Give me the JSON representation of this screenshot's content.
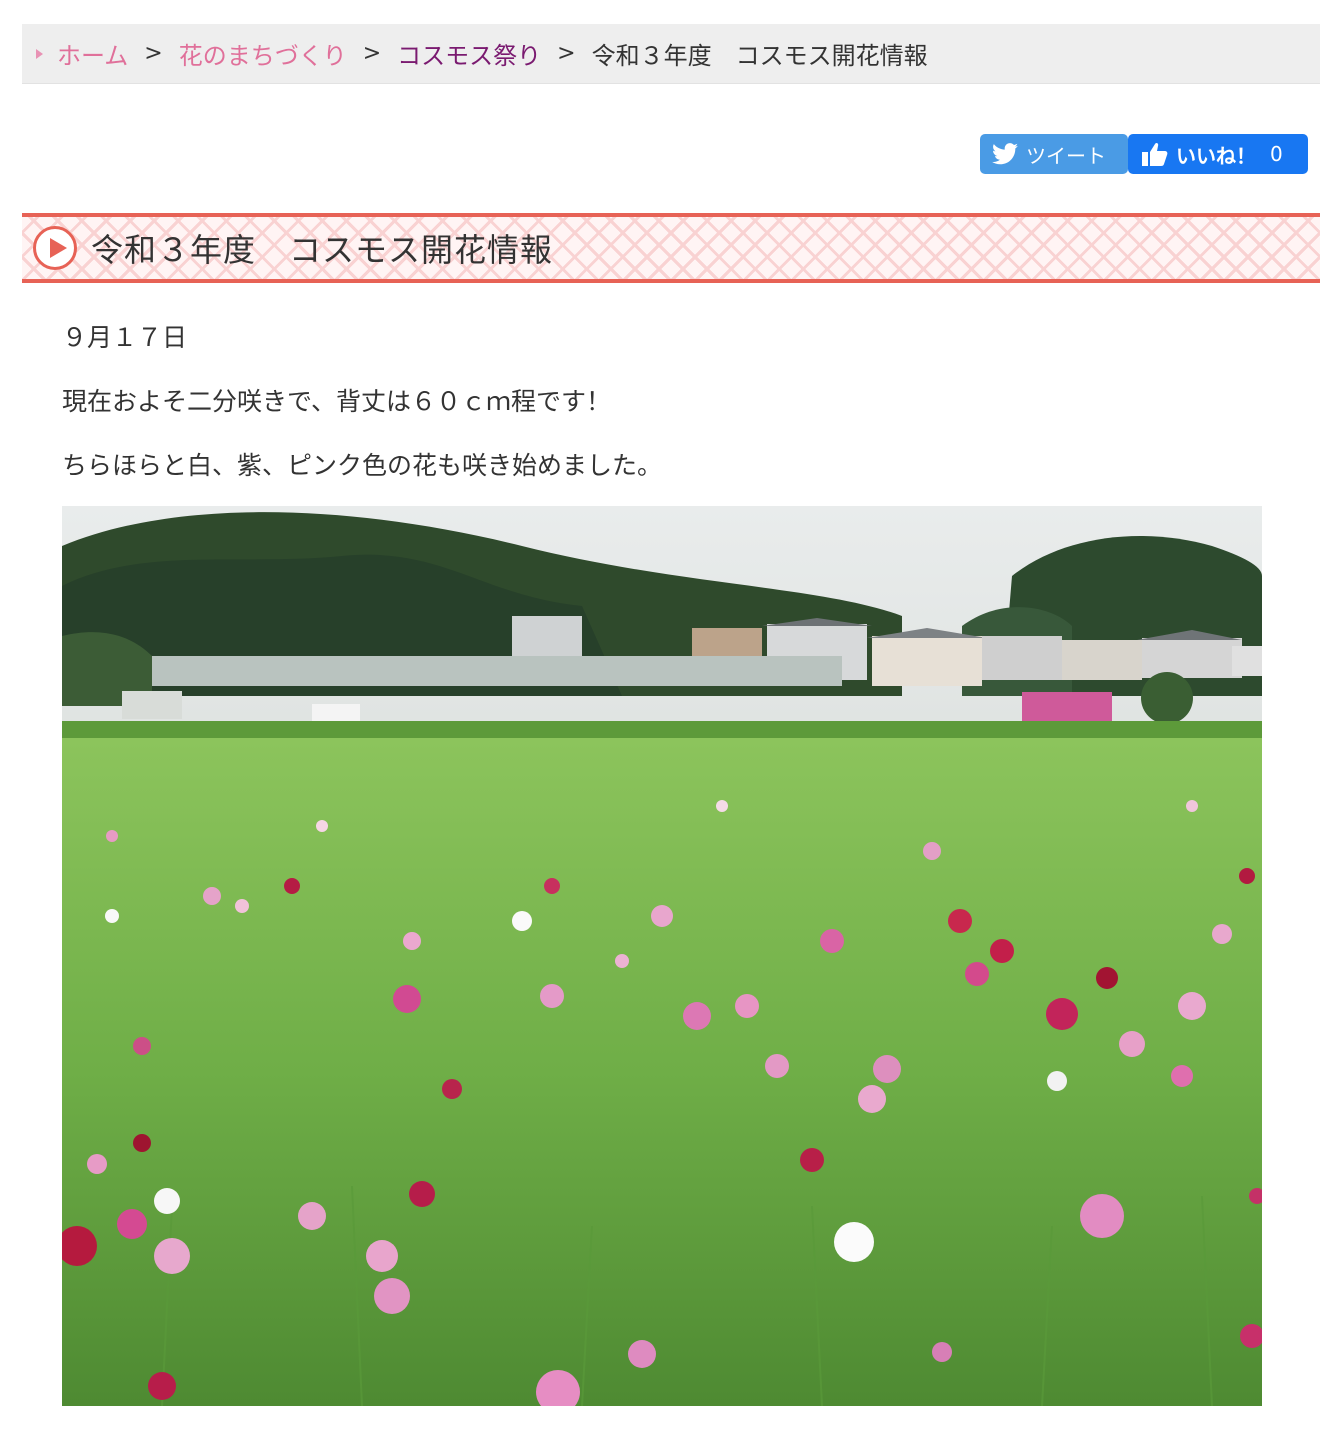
{
  "breadcrumb": {
    "home": "ホーム",
    "flower_town": "花のまちづくり",
    "cosmos_festival": "コスモス祭り",
    "current": "令和３年度　コスモス開花情報",
    "separator": ">"
  },
  "social": {
    "tweet_label": "ツイート",
    "like_label": "いいね！",
    "like_count": "0",
    "tweet_icon": "twitter-bird-icon",
    "like_icon": "thumbs-up-icon"
  },
  "article": {
    "title": "令和３年度　コスモス開花情報",
    "date": "９月１７日",
    "paragraph1": "現在およそ二分咲きで、背丈は６０ｃｍ程です！",
    "paragraph2": "ちらほらと白、紫、ピンク色の花も咲き始めました。"
  },
  "colors": {
    "accent_red": "#e76256",
    "link_pink": "#e0709a",
    "link_purple": "#7a1a70",
    "twitter_blue": "#4a9be5",
    "facebook_blue": "#1877f2"
  }
}
